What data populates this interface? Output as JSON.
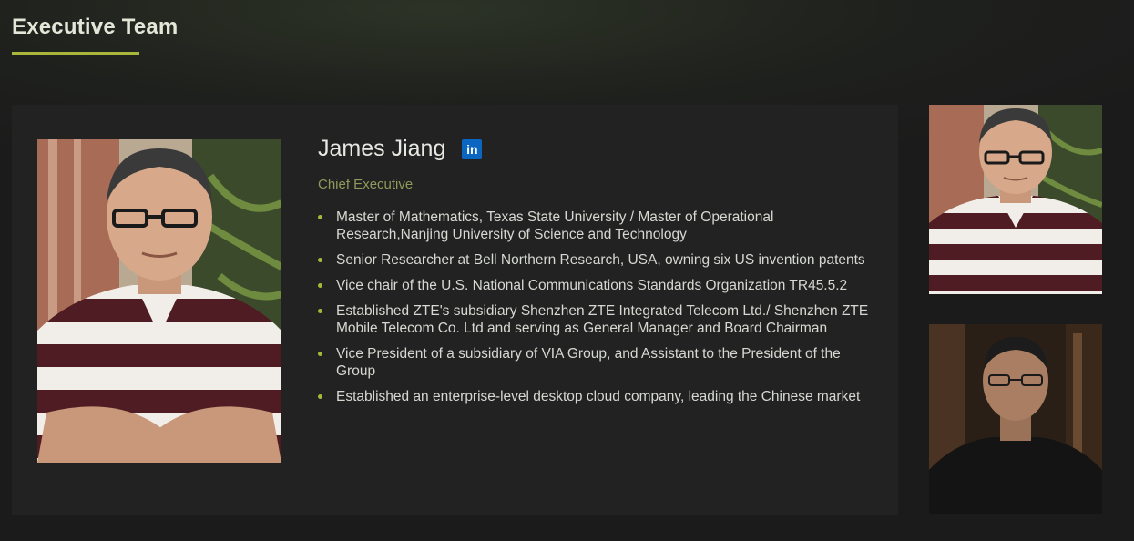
{
  "section": {
    "title": "Executive Team"
  },
  "profile": {
    "name": "James Jiang",
    "linkedin_label": "in",
    "role": "Chief Executive",
    "bullets": [
      "Master of Mathematics, Texas State University / Master of Operational Research,Nanjing University of Science and Technology",
      "Senior Researcher at Bell Northern Research, USA, owning six US invention patents",
      "Vice chair of the U.S. National Communications Standards Organization TR45.5.2",
      "Established ZTE's subsidiary Shenzhen ZTE Integrated Telecom Ltd./ Shenzhen ZTE Mobile Telecom Co. Ltd and serving as General Manager and Board Chairman",
      "Vice President of a subsidiary of VIA Group, and Assistant to the President of the Group",
      "Established an enterprise-level desktop cloud company, leading the Chinese market"
    ]
  },
  "colors": {
    "accent": "#a8b73c",
    "role": "#8d9a5a",
    "card_bg": "#222222",
    "linkedin": "#0b66c2"
  }
}
